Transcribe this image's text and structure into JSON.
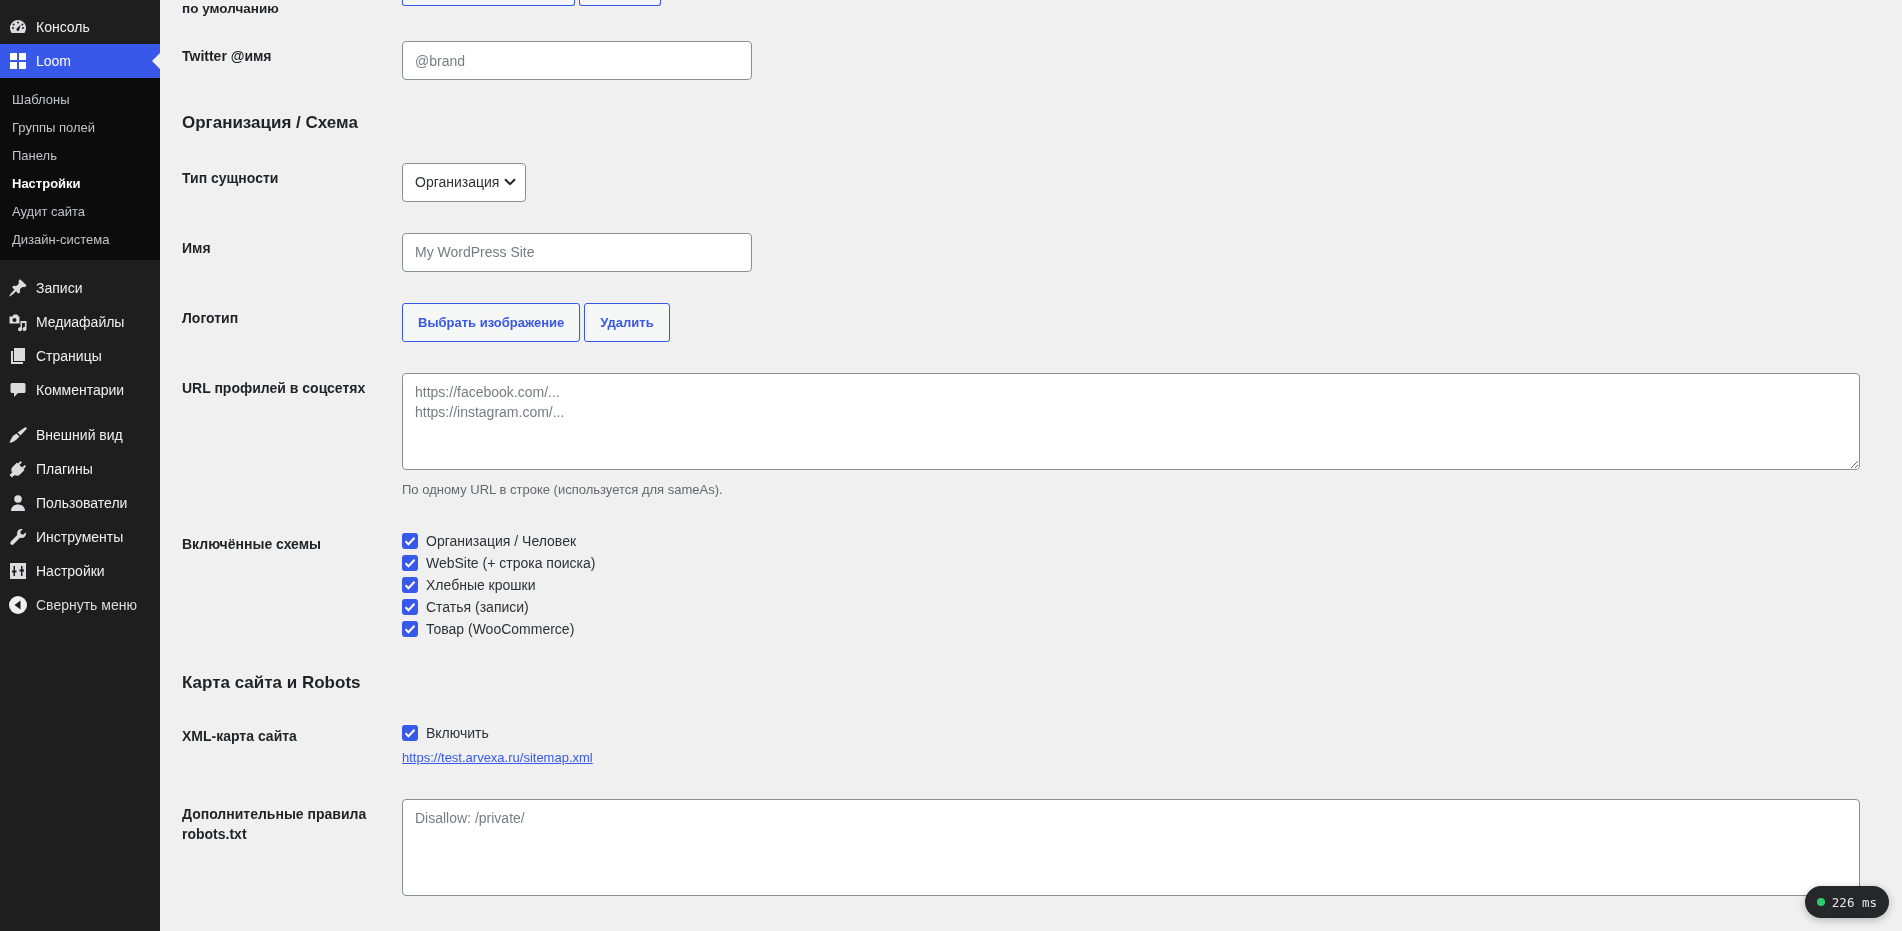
{
  "sidebar": {
    "groups": [
      {
        "items": [
          {
            "label": "Консоль",
            "selected": false
          },
          {
            "label": "Loom",
            "selected": true,
            "children": [
              {
                "label": "Шаблоны",
                "selected": false
              },
              {
                "label": "Группы полей",
                "selected": false
              },
              {
                "label": "Панель",
                "selected": false
              },
              {
                "label": "Настройки",
                "selected": true
              },
              {
                "label": "Аудит сайта",
                "selected": false
              },
              {
                "label": "Дизайн-система",
                "selected": false
              }
            ]
          }
        ]
      },
      {
        "items": [
          {
            "label": "Записи",
            "selected": false
          },
          {
            "label": "Медиафайлы",
            "selected": false
          },
          {
            "label": "Страницы",
            "selected": false
          },
          {
            "label": "Комментарии",
            "selected": false
          }
        ]
      },
      {
        "items": [
          {
            "label": "Внешний вид",
            "selected": false
          },
          {
            "label": "Плагины",
            "selected": false
          },
          {
            "label": "Пользователи",
            "selected": false
          },
          {
            "label": "Инструменты",
            "selected": false
          },
          {
            "label": "Настройки",
            "selected": false
          }
        ]
      }
    ],
    "collapse": {
      "label": "Свернуть меню"
    }
  },
  "form": {
    "rows": [
      {
        "kind": "media_cut",
        "label": "по умолчанию"
      },
      {
        "kind": "text",
        "label": "Twitter @имя",
        "placeholder": "@brand"
      },
      {
        "kind": "heading",
        "label": "Организация / Схема"
      },
      {
        "kind": "select",
        "label": "Тип сущности",
        "value": "Организация"
      },
      {
        "kind": "text",
        "label": "Имя",
        "placeholder": "My WordPress Site"
      },
      {
        "kind": "media",
        "label": "Логотип",
        "buttons": [
          "Выбрать изображение",
          "Удалить"
        ]
      },
      {
        "kind": "textarea",
        "label": "URL профилей в соцсетях",
        "placeholder": "https://facebook.com/...\nhttps://instagram.com/...",
        "help": "По одному URL в строке (используется для sameAs)."
      },
      {
        "kind": "checkboxes",
        "label": "Включённые схемы",
        "options": [
          {
            "label": "Организация / Человек",
            "checked": true
          },
          {
            "label": "WebSite (+ строка поиска)",
            "checked": true
          },
          {
            "label": "Хлебные крошки",
            "checked": true
          },
          {
            "label": "Статья (записи)",
            "checked": true
          },
          {
            "label": "Товар (WooCommerce)",
            "checked": true
          }
        ]
      },
      {
        "kind": "heading",
        "label": "Карта сайта и Robots"
      },
      {
        "kind": "checkboxes",
        "label": "XML-карта сайта",
        "options": [
          {
            "label": "Включить",
            "checked": true
          }
        ],
        "link": "https://test.arvexa.ru/sitemap.xml"
      },
      {
        "kind": "textarea",
        "label": "Дополнительные правила robots.txt",
        "placeholder": "Disallow: /private/"
      }
    ]
  },
  "timing_badge": {
    "text": "226 ms"
  }
}
